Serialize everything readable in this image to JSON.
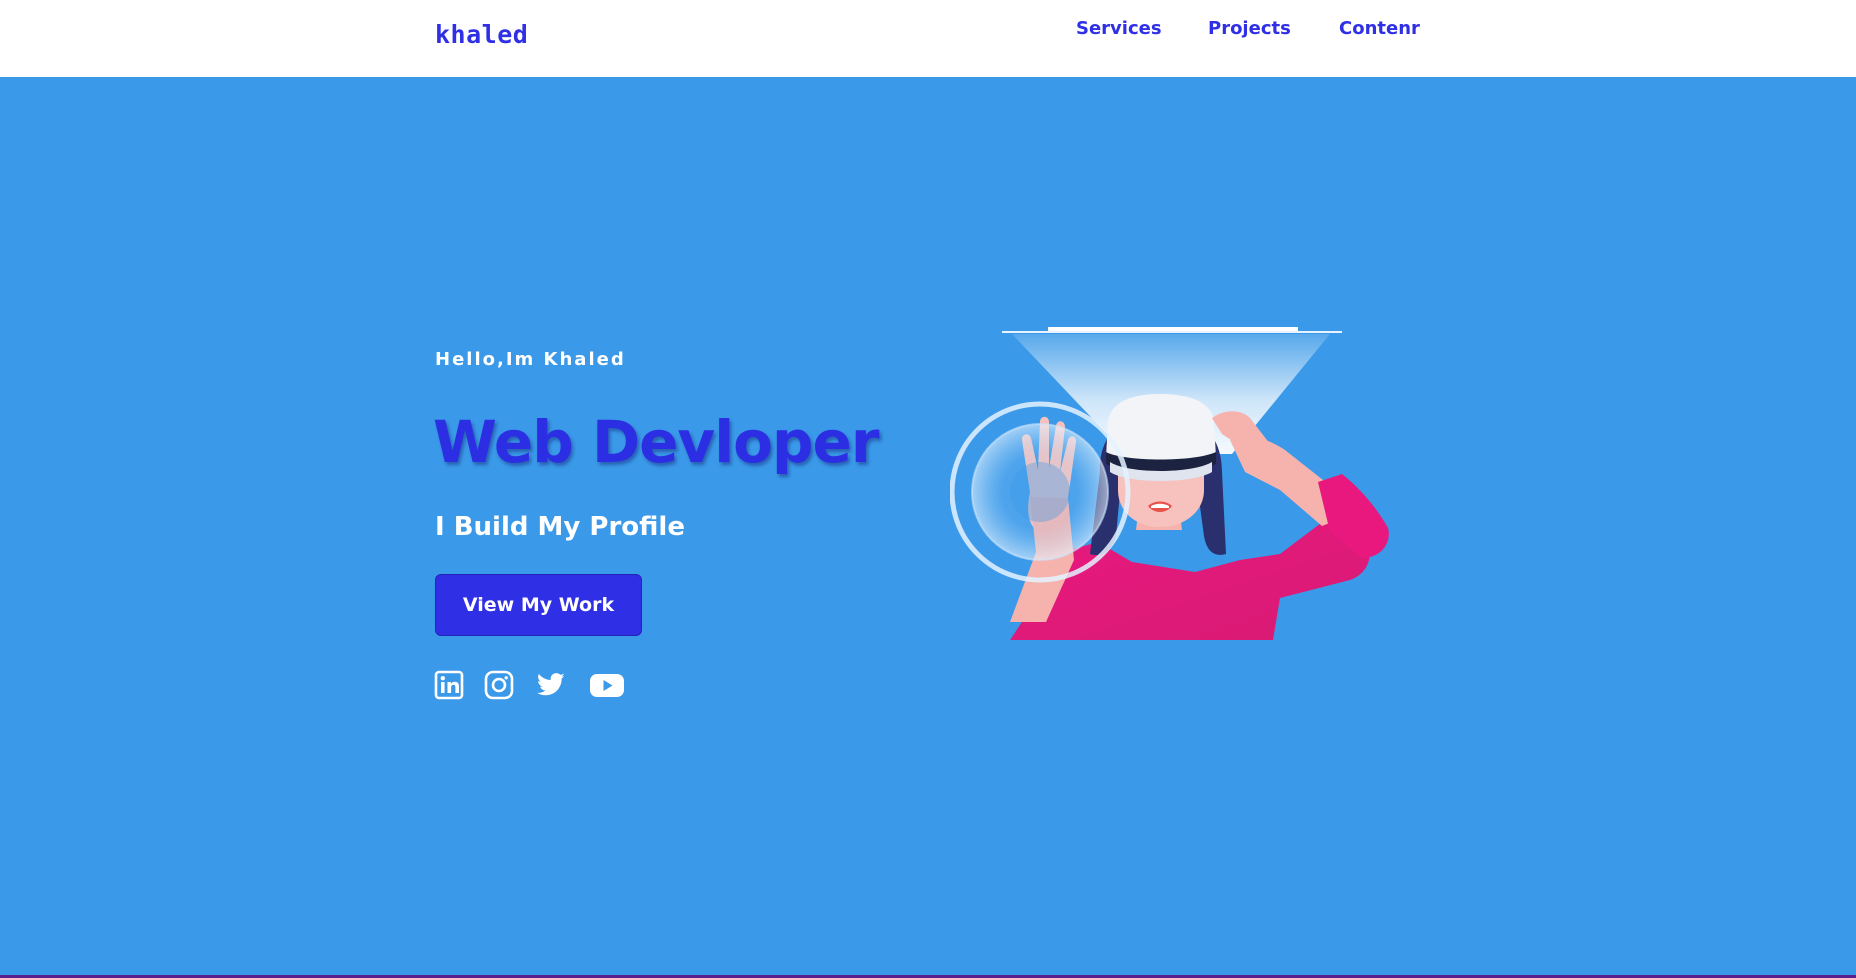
{
  "nav": {
    "logo": "khaled",
    "links": [
      "Services",
      "Projects",
      "Contenr"
    ]
  },
  "hero": {
    "greeting": "Hello,Im Khaled",
    "headline": "Web Devloper",
    "subheadline": "I Build My Profile",
    "cta_label": "View My Work",
    "social_icons": [
      "linkedin-icon",
      "instagram-icon",
      "twitter-icon",
      "youtube-icon"
    ]
  },
  "colors": {
    "background": "#3a99e8",
    "brand": "#2f2fe6",
    "navbar": "#ffffff",
    "text_light": "#ffffff"
  }
}
